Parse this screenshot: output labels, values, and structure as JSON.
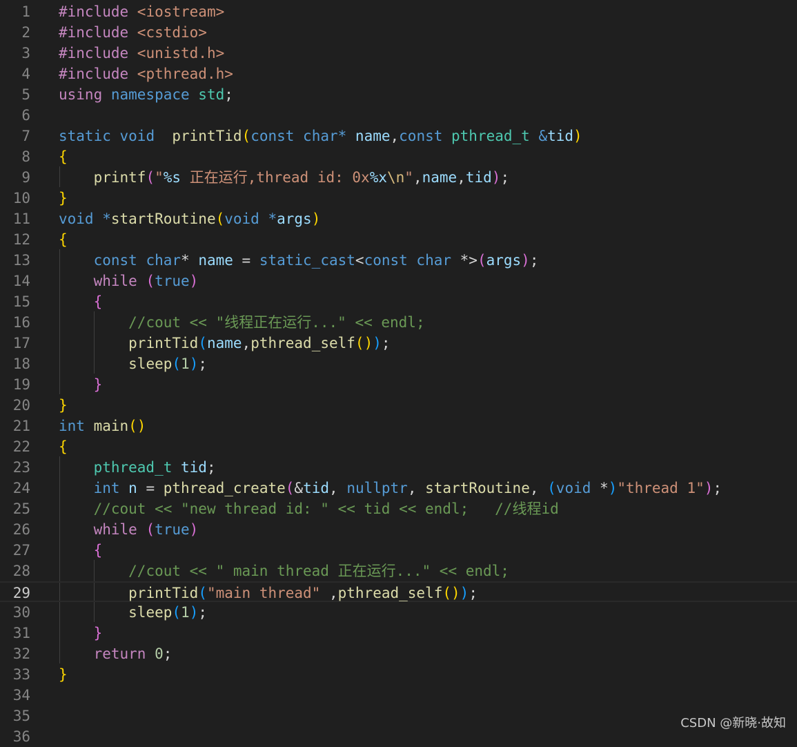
{
  "language": "cpp",
  "active_line": 29,
  "watermark": "CSDN @新晓·故知",
  "colors": {
    "background": "#1f1f1f",
    "line_number": "#858585",
    "keyword": "#569cd6",
    "control": "#c586c0",
    "type": "#4ec9b0",
    "function": "#dcdcaa",
    "variable": "#9cdcfe",
    "string": "#ce9178",
    "number": "#b5cea8",
    "comment": "#6a9955"
  },
  "lines": [
    {
      "num": "1",
      "tokens": [
        {
          "t": "#include ",
          "c": "dir"
        },
        {
          "t": "<iostream>",
          "c": "inc"
        }
      ]
    },
    {
      "num": "2",
      "tokens": [
        {
          "t": "#include ",
          "c": "dir"
        },
        {
          "t": "<cstdio>",
          "c": "inc"
        }
      ]
    },
    {
      "num": "3",
      "tokens": [
        {
          "t": "#include ",
          "c": "dir"
        },
        {
          "t": "<unistd.h>",
          "c": "inc"
        }
      ]
    },
    {
      "num": "4",
      "tokens": [
        {
          "t": "#include ",
          "c": "dir"
        },
        {
          "t": "<pthread.h>",
          "c": "inc"
        }
      ]
    },
    {
      "num": "5",
      "tokens": [
        {
          "t": "using ",
          "c": "ctl"
        },
        {
          "t": "namespace ",
          "c": "kw"
        },
        {
          "t": "std",
          "c": "type"
        },
        {
          "t": ";",
          "c": "op"
        }
      ]
    },
    {
      "num": "6",
      "tokens": []
    },
    {
      "num": "7",
      "tokens": [
        {
          "t": "static ",
          "c": "kw"
        },
        {
          "t": "void  ",
          "c": "kw"
        },
        {
          "t": "printTid",
          "c": "fn"
        },
        {
          "t": "(",
          "c": "b1"
        },
        {
          "t": "const ",
          "c": "kw"
        },
        {
          "t": "char",
          "c": "kw"
        },
        {
          "t": "* ",
          "c": "kw"
        },
        {
          "t": "name",
          "c": "var"
        },
        {
          "t": ",",
          "c": "op"
        },
        {
          "t": "const ",
          "c": "kw"
        },
        {
          "t": "pthread_t ",
          "c": "type"
        },
        {
          "t": "&",
          "c": "kw"
        },
        {
          "t": "tid",
          "c": "var"
        },
        {
          "t": ")",
          "c": "b1"
        }
      ]
    },
    {
      "num": "8",
      "tokens": [
        {
          "t": "{",
          "c": "b1"
        }
      ]
    },
    {
      "num": "9",
      "tokens": [
        {
          "t": "    ",
          "c": "op"
        },
        {
          "t": "printf",
          "c": "fn"
        },
        {
          "t": "(",
          "c": "b2"
        },
        {
          "t": "\"",
          "c": "str"
        },
        {
          "t": "%s",
          "c": "fmt"
        },
        {
          "t": " 正在运行,thread id: 0x",
          "c": "str"
        },
        {
          "t": "%x",
          "c": "fmt"
        },
        {
          "t": "\\n",
          "c": "esc"
        },
        {
          "t": "\"",
          "c": "str"
        },
        {
          "t": ",",
          "c": "op"
        },
        {
          "t": "name",
          "c": "var"
        },
        {
          "t": ",",
          "c": "op"
        },
        {
          "t": "tid",
          "c": "var"
        },
        {
          "t": ")",
          "c": "b2"
        },
        {
          "t": ";",
          "c": "op"
        }
      ]
    },
    {
      "num": "10",
      "tokens": [
        {
          "t": "}",
          "c": "b1"
        }
      ]
    },
    {
      "num": "11",
      "tokens": [
        {
          "t": "void ",
          "c": "kw"
        },
        {
          "t": "*",
          "c": "kw"
        },
        {
          "t": "startRoutine",
          "c": "fn"
        },
        {
          "t": "(",
          "c": "b1"
        },
        {
          "t": "void ",
          "c": "kw"
        },
        {
          "t": "*",
          "c": "kw"
        },
        {
          "t": "args",
          "c": "var"
        },
        {
          "t": ")",
          "c": "b1"
        }
      ]
    },
    {
      "num": "12",
      "tokens": [
        {
          "t": "{",
          "c": "b1"
        }
      ]
    },
    {
      "num": "13",
      "tokens": [
        {
          "t": "    ",
          "c": "op"
        },
        {
          "t": "const ",
          "c": "kw"
        },
        {
          "t": "char",
          "c": "kw"
        },
        {
          "t": "* ",
          "c": "op"
        },
        {
          "t": "name",
          "c": "var"
        },
        {
          "t": " = ",
          "c": "op"
        },
        {
          "t": "static_cast",
          "c": "kw"
        },
        {
          "t": "<",
          "c": "op"
        },
        {
          "t": "const ",
          "c": "kw"
        },
        {
          "t": "char ",
          "c": "kw"
        },
        {
          "t": "*>",
          "c": "op"
        },
        {
          "t": "(",
          "c": "b2"
        },
        {
          "t": "args",
          "c": "var"
        },
        {
          "t": ")",
          "c": "b2"
        },
        {
          "t": ";",
          "c": "op"
        }
      ]
    },
    {
      "num": "14",
      "tokens": [
        {
          "t": "    ",
          "c": "op"
        },
        {
          "t": "while ",
          "c": "ctl"
        },
        {
          "t": "(",
          "c": "b2"
        },
        {
          "t": "true",
          "c": "kw"
        },
        {
          "t": ")",
          "c": "b2"
        }
      ]
    },
    {
      "num": "15",
      "tokens": [
        {
          "t": "    ",
          "c": "op"
        },
        {
          "t": "{",
          "c": "b2"
        }
      ]
    },
    {
      "num": "16",
      "tokens": [
        {
          "t": "        ",
          "c": "op"
        },
        {
          "t": "//cout << \"线程正在运行...\" << endl;",
          "c": "cmt"
        }
      ]
    },
    {
      "num": "17",
      "tokens": [
        {
          "t": "        ",
          "c": "op"
        },
        {
          "t": "printTid",
          "c": "fn"
        },
        {
          "t": "(",
          "c": "b3"
        },
        {
          "t": "name",
          "c": "var"
        },
        {
          "t": ",",
          "c": "op"
        },
        {
          "t": "pthread_self",
          "c": "fn"
        },
        {
          "t": "()",
          "c": "b1"
        },
        {
          "t": ")",
          "c": "b3"
        },
        {
          "t": ";",
          "c": "op"
        }
      ]
    },
    {
      "num": "18",
      "tokens": [
        {
          "t": "        ",
          "c": "op"
        },
        {
          "t": "sleep",
          "c": "fn"
        },
        {
          "t": "(",
          "c": "b3"
        },
        {
          "t": "1",
          "c": "num"
        },
        {
          "t": ")",
          "c": "b3"
        },
        {
          "t": ";",
          "c": "op"
        }
      ]
    },
    {
      "num": "19",
      "tokens": [
        {
          "t": "    ",
          "c": "op"
        },
        {
          "t": "}",
          "c": "b2"
        }
      ]
    },
    {
      "num": "20",
      "tokens": [
        {
          "t": "}",
          "c": "b1"
        }
      ]
    },
    {
      "num": "21",
      "tokens": [
        {
          "t": "int ",
          "c": "kw"
        },
        {
          "t": "main",
          "c": "fn"
        },
        {
          "t": "()",
          "c": "b1"
        }
      ]
    },
    {
      "num": "22",
      "tokens": [
        {
          "t": "{",
          "c": "b1"
        }
      ]
    },
    {
      "num": "23",
      "tokens": [
        {
          "t": "    ",
          "c": "op"
        },
        {
          "t": "pthread_t ",
          "c": "type"
        },
        {
          "t": "tid",
          "c": "var"
        },
        {
          "t": ";",
          "c": "op"
        }
      ]
    },
    {
      "num": "24",
      "tokens": [
        {
          "t": "    ",
          "c": "op"
        },
        {
          "t": "int ",
          "c": "kw"
        },
        {
          "t": "n",
          "c": "var"
        },
        {
          "t": " = ",
          "c": "op"
        },
        {
          "t": "pthread_create",
          "c": "fn"
        },
        {
          "t": "(",
          "c": "b2"
        },
        {
          "t": "&",
          "c": "op"
        },
        {
          "t": "tid",
          "c": "var"
        },
        {
          "t": ", ",
          "c": "op"
        },
        {
          "t": "nullptr",
          "c": "kw"
        },
        {
          "t": ", ",
          "c": "op"
        },
        {
          "t": "startRoutine",
          "c": "fn"
        },
        {
          "t": ", ",
          "c": "op"
        },
        {
          "t": "(",
          "c": "b3"
        },
        {
          "t": "void ",
          "c": "kw"
        },
        {
          "t": "*",
          "c": "op"
        },
        {
          "t": ")",
          "c": "b3"
        },
        {
          "t": "\"thread 1\"",
          "c": "str"
        },
        {
          "t": ")",
          "c": "b2"
        },
        {
          "t": ";",
          "c": "op"
        }
      ]
    },
    {
      "num": "25",
      "tokens": [
        {
          "t": "    ",
          "c": "op"
        },
        {
          "t": "//cout << \"new thread id: \" << tid << endl;   //线程id",
          "c": "cmt"
        }
      ]
    },
    {
      "num": "26",
      "tokens": [
        {
          "t": "    ",
          "c": "op"
        },
        {
          "t": "while ",
          "c": "ctl"
        },
        {
          "t": "(",
          "c": "b2"
        },
        {
          "t": "true",
          "c": "kw"
        },
        {
          "t": ")",
          "c": "b2"
        }
      ]
    },
    {
      "num": "27",
      "tokens": [
        {
          "t": "    ",
          "c": "op"
        },
        {
          "t": "{",
          "c": "b2"
        }
      ]
    },
    {
      "num": "28",
      "tokens": [
        {
          "t": "        ",
          "c": "op"
        },
        {
          "t": "//cout << \" main thread 正在运行...\" << endl;",
          "c": "cmt"
        }
      ]
    },
    {
      "num": "29",
      "tokens": [
        {
          "t": "        ",
          "c": "op"
        },
        {
          "t": "printTid",
          "c": "fn"
        },
        {
          "t": "(",
          "c": "b3"
        },
        {
          "t": "\"main thread\"",
          "c": "str"
        },
        {
          "t": " ,",
          "c": "op"
        },
        {
          "t": "pthread_self",
          "c": "fn"
        },
        {
          "t": "()",
          "c": "b1"
        },
        {
          "t": ")",
          "c": "b3"
        },
        {
          "t": ";",
          "c": "op"
        }
      ]
    },
    {
      "num": "30",
      "tokens": [
        {
          "t": "        ",
          "c": "op"
        },
        {
          "t": "sleep",
          "c": "fn"
        },
        {
          "t": "(",
          "c": "b3"
        },
        {
          "t": "1",
          "c": "num"
        },
        {
          "t": ")",
          "c": "b3"
        },
        {
          "t": ";",
          "c": "op"
        }
      ]
    },
    {
      "num": "31",
      "tokens": [
        {
          "t": "    ",
          "c": "op"
        },
        {
          "t": "}",
          "c": "b2"
        }
      ]
    },
    {
      "num": "32",
      "tokens": [
        {
          "t": "    ",
          "c": "op"
        },
        {
          "t": "return ",
          "c": "ctl"
        },
        {
          "t": "0",
          "c": "num"
        },
        {
          "t": ";",
          "c": "op"
        }
      ]
    },
    {
      "num": "33",
      "tokens": [
        {
          "t": "}",
          "c": "b1"
        }
      ]
    },
    {
      "num": "34",
      "tokens": []
    },
    {
      "num": "35",
      "tokens": []
    },
    {
      "num": "36",
      "tokens": []
    }
  ]
}
